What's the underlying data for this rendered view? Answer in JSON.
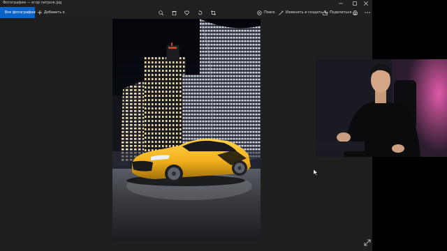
{
  "window": {
    "title": "Фотографии — егор питрож.jpg",
    "controls": [
      "minimize-icon",
      "maximize-icon",
      "close-icon"
    ]
  },
  "toolbar": {
    "all_photos_label": "Все фотографии",
    "add_to_label": "Добавить к",
    "search_label": "Поиск",
    "edit_create_label": "Изменить и создать",
    "share_label": "Поделиться",
    "tools": [
      "zoom-icon",
      "delete-icon",
      "favorite-icon",
      "rotate-icon",
      "crop-icon",
      "print-icon",
      "more-icon"
    ]
  },
  "colors": {
    "accent": "#0a64c8",
    "car": "#f2b01c",
    "window_bg": "#1f1f1f"
  },
  "photo": {
    "subject": "yellow-sports-car-night-city"
  },
  "overlay": {
    "webcam": "presenter-webcam"
  }
}
